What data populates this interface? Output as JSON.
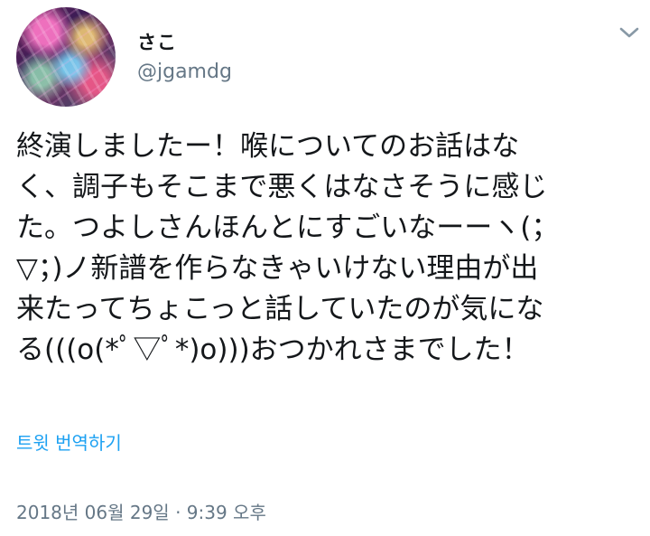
{
  "author": {
    "display_name": "さこ",
    "username": "@jgamdg"
  },
  "tweet": {
    "text_lines": [
      "終演しましたー！喉についてのお話はな",
      "く、調子もそこまで悪くはなさそうに感じ",
      "た。つよしさんほんとにすごいなーーヽ(；",
      "▽；)ノ新譜を作らなきゃいけない理由が出",
      "来たってちょこっと話していたのが気にな",
      "る(((o(*ﾟ▽ﾟ*)o)))おつかれさまでした！"
    ]
  },
  "actions": {
    "translate_label": "트윗 번역하기",
    "menu_icon": "chevron-down-icon"
  },
  "meta": {
    "timestamp": "2018년 06월 29일 · 9:39 오후"
  },
  "colors": {
    "text": "#14171a",
    "secondary": "#657786",
    "link": "#1da1f2",
    "chevron": "#8899a6"
  }
}
